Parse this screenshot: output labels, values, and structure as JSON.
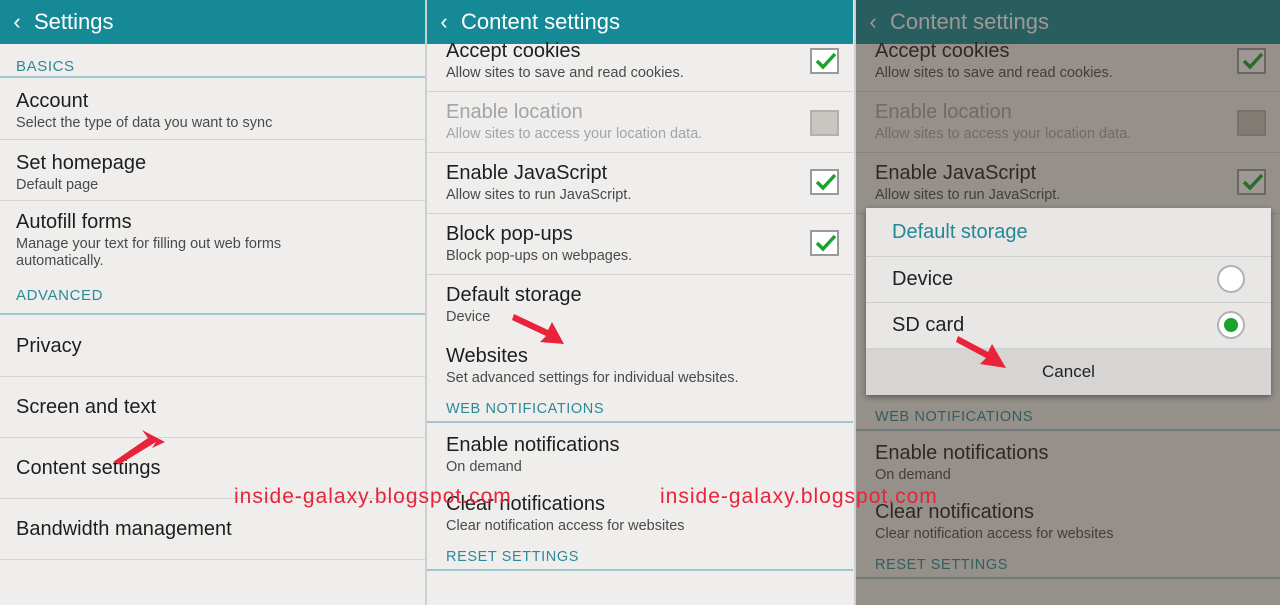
{
  "panel1": {
    "title": "Settings",
    "sections": [
      {
        "label": "BASICS"
      },
      {
        "label": "ADVANCED"
      }
    ],
    "items": [
      {
        "title": "Account",
        "subtitle": "Select the type of data you want to sync"
      },
      {
        "title": "Set homepage",
        "subtitle": "Default page"
      },
      {
        "title": "Autofill forms",
        "subtitle": "Manage your text for filling out web forms automatically."
      },
      {
        "title": "Privacy"
      },
      {
        "title": "Screen and text"
      },
      {
        "title": "Content settings"
      },
      {
        "title": "Bandwidth management"
      }
    ]
  },
  "panel2": {
    "title": "Content settings",
    "items": [
      {
        "title": "Accept cookies",
        "subtitle": "Allow sites to save and read cookies.",
        "checked": true
      },
      {
        "title": "Enable location",
        "subtitle": "Allow sites to access your location data.",
        "checked": false,
        "disabled": true
      },
      {
        "title": "Enable JavaScript",
        "subtitle": "Allow sites to run JavaScript.",
        "checked": true
      },
      {
        "title": "Block pop-ups",
        "subtitle": "Block pop-ups on webpages.",
        "checked": true
      },
      {
        "title": "Default storage",
        "subtitle": "Device"
      },
      {
        "title": "Websites",
        "subtitle": "Set advanced settings for individual websites."
      }
    ],
    "section_web": "WEB NOTIFICATIONS",
    "notif_items": [
      {
        "title": "Enable notifications",
        "subtitle": "On demand"
      },
      {
        "title": "Clear notifications",
        "subtitle": "Clear notification access for websites"
      }
    ],
    "section_reset": "RESET SETTINGS"
  },
  "panel3": {
    "title": "Content settings",
    "items": [
      {
        "title": "Accept cookies",
        "subtitle": "Allow sites to save and read cookies."
      },
      {
        "title": "Enable location",
        "subtitle": "Allow sites to access your location data."
      },
      {
        "title": "Enable JavaScript",
        "subtitle": "Allow sites to run JavaScript."
      }
    ],
    "section_web": "WEB NOTIFICATIONS",
    "notif_items": [
      {
        "title": "Enable notifications",
        "subtitle": "On demand"
      },
      {
        "title": "Clear notifications",
        "subtitle": "Clear notification access for websites"
      }
    ],
    "section_reset": "RESET SETTINGS",
    "dialog": {
      "title": "Default storage",
      "options": [
        {
          "label": "Device",
          "selected": false
        },
        {
          "label": "SD card",
          "selected": true
        }
      ],
      "cancel": "Cancel"
    }
  },
  "watermarks": [
    "inside-galaxy.blogspot.com",
    "inside-galaxy.blogspot.com"
  ],
  "colors": {
    "accent": "#158a96",
    "check": "#1aa22c",
    "annotation": "#e8233a"
  }
}
